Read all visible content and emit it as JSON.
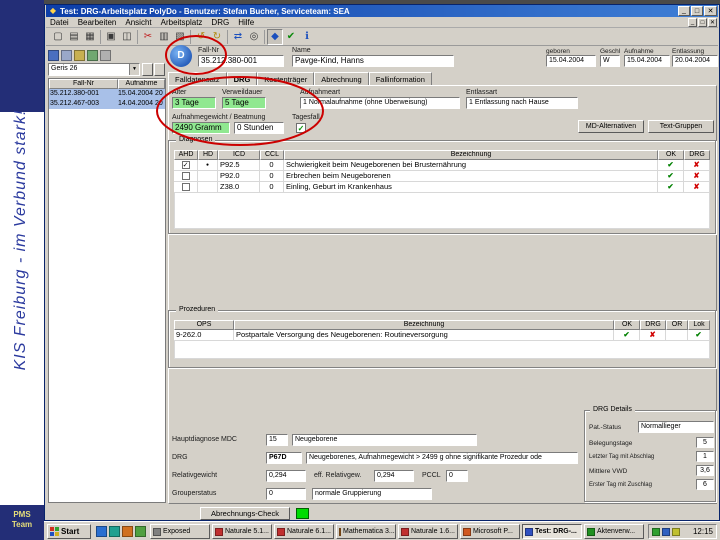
{
  "slide": {
    "vertical_text": "KIS Freiburg - im Verbund stark!",
    "team_line1": "PMS",
    "team_line2": "Team"
  },
  "window": {
    "title": "Test: DRG-Arbeitsplatz PolyDo - Benutzer: Stefan Bucher, Serviceteam: SEA",
    "menus": [
      "Datei",
      "Bearbeiten",
      "Ansicht",
      "Arbeitsplatz",
      "DRG",
      "Hilfe"
    ]
  },
  "icons": {
    "app": "◆",
    "patient": "D",
    "new": "▢",
    "open": "▤",
    "save": "▦",
    "print": "▣",
    "preview": "◫",
    "cut": "✂",
    "copy": "▥",
    "paste": "▧",
    "undo": "↺",
    "redo": "↻",
    "refresh": "⇄",
    "search": "◎",
    "grouper": "◆",
    "check_tool": "✔",
    "info": "ℹ",
    "minimize": "_",
    "maximize": "□",
    "close": "✕",
    "dropdown": "▼"
  },
  "case_nav": {
    "combo_value": "Geris 26",
    "list": {
      "columns": [
        "Fall-Nr",
        "Aufnahme"
      ],
      "rows": [
        {
          "fall": "35.212.380-001",
          "date": "15.04.2004 20"
        },
        {
          "fall": "35.212.467-003",
          "date": "14.04.2004 20"
        }
      ]
    }
  },
  "patient": {
    "fall_label": "Fall-Nr",
    "fall": "35.212.380-001",
    "name_label": "Name",
    "name": "Pavge-Kind, Hanns",
    "geb_label": "geboren",
    "geb": "15.04.2004",
    "geschl_label": "Geschl",
    "geschl": "W",
    "aufn_label": "Aufnahme",
    "aufn": "15.04.2004",
    "entl_label": "Entlassung",
    "entl": "20.04.2004"
  },
  "tabs": [
    "Falldatensatz",
    "DRG",
    "Kostenträger",
    "Abrechnung",
    "Fallinformation"
  ],
  "form": {
    "alter_label": "Alter",
    "alter": "3 Tage",
    "vwd_label": "Verweildauer",
    "vwd": "5 Tage",
    "aufnahmeart_label": "Aufnahmeart",
    "aufnahmeart": "1 Normalaufnahme (ohne Überweisung)",
    "entlassart_label": "Entlassart",
    "entlassart": "1 Entlassung nach Hause",
    "gewicht_label": "Aufnahmegewicht / Beatmung",
    "gewicht": "2490 Gramm",
    "beatmung": "0 Stunden",
    "tagesfall_label": "Tagesfall",
    "tagesfall_checked": "✓",
    "md_btn": "MD-Alternativen",
    "tg_btn": "Text-Gruppen"
  },
  "diagnosen": {
    "title": "Diagnosen",
    "cols": [
      "AHD",
      "HD",
      "ICD",
      "CCL",
      "Bezeichnung",
      "OK",
      "DRG"
    ],
    "rows": [
      {
        "ahd": "✓",
        "hd": "●",
        "icd": "P92.5",
        "ccl": "0",
        "text": "Schwierigkeit beim Neugeborenen bei Brusternährung",
        "ok": "✔",
        "drg": "✘"
      },
      {
        "ahd": "",
        "hd": "",
        "icd": "P92.0",
        "ccl": "0",
        "text": "Erbrechen beim Neugeborenen",
        "ok": "✔",
        "drg": "✘"
      },
      {
        "ahd": "",
        "hd": "",
        "icd": "Z38.0",
        "ccl": "0",
        "text": "Einling, Geburt im Krankenhaus",
        "ok": "✔",
        "drg": "✘"
      }
    ]
  },
  "prozeduren": {
    "title": "Prozeduren",
    "cols": [
      "OPS",
      "Bezeichnung",
      "OK",
      "DRG",
      "OR",
      "Lok"
    ],
    "rows": [
      {
        "ops": "9-262.0",
        "text": "Postpartale Versorgung des Neugeborenen: Routineversorgung",
        "ok": "✔",
        "drg": "✘",
        "or": "",
        "lok": "✔"
      }
    ]
  },
  "drg": {
    "mdc_label": "Hauptdiagnose MDC",
    "mdc": "15",
    "mdc_text": "Neugeborene",
    "drg_label": "DRG",
    "code": "P67D",
    "text": "Neugeborenes, Aufnahmegewicht > 2499 g ohne signifikante Prozedur ode",
    "rel_label": "Relativgewicht",
    "rel": "0,294",
    "eff_label": "eff. Relativgew.",
    "eff": "0,294",
    "pccl_label": "PCCL",
    "pccl": "0",
    "status_label": "Grouperstatus",
    "status_code": "0",
    "status_text": "normale Gruppierung"
  },
  "details": {
    "title": "DRG Details",
    "rows": [
      {
        "label": "Pat.-Status",
        "value": "Normallieger"
      },
      {
        "label": "Belegungstage",
        "value": "5"
      },
      {
        "label": "Letzter Tag mit Abschlag",
        "value": "1"
      },
      {
        "label": "Mittlere VWD",
        "value": "3,6"
      },
      {
        "label": "Erster Tag mit Zuschlag",
        "value": "6"
      }
    ]
  },
  "footer": {
    "check_button": "Abrechnungs-Check"
  },
  "taskbar": {
    "start": "Start",
    "items": [
      "Exposed",
      "Naturale 5.1...",
      "Naturale 6.1...",
      "Mathematica 3...",
      "Naturale 1.6...",
      "Microsoft P...",
      "Test: DRG-...",
      "Aktenverw..."
    ],
    "time": "12:15"
  }
}
